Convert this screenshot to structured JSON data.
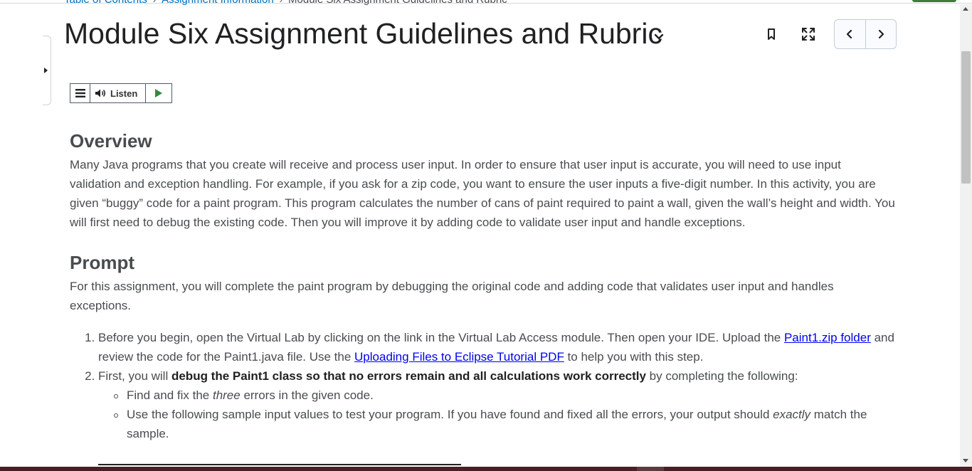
{
  "breadcrumb": {
    "items": [
      "Table of Contents",
      "Assignment Information",
      "Module Six Assignment Guidelines and Rubric"
    ]
  },
  "page": {
    "title": "Module Six Assignment Guidelines and Rubric"
  },
  "icons": {
    "side_toggle": "caret-right-icon",
    "title_menu": "chevron-down-icon",
    "bookmark": "bookmark-icon",
    "fullscreen": "fullscreen-icon",
    "prev": "chevron-left-icon",
    "next": "chevron-right-icon",
    "listen_menu": "hamburger-icon",
    "speaker": "speaker-icon",
    "play": "play-icon"
  },
  "listen": {
    "label": "Listen"
  },
  "overview": {
    "heading": "Overview",
    "text": "Many Java programs that you create will receive and process user input. In order to ensure that user input is accurate, you will need to use input validation and exception handling. For example, if you ask for a zip code, you want to ensure the user inputs a five-digit number. In this activity, you are given “buggy” code for a paint program. This program calculates the number of cans of paint required to paint a wall, given the wall’s height and width. You will first need to debug the existing code. Then you will improve it by adding code to validate user input and handle exceptions."
  },
  "prompt": {
    "heading": "Prompt",
    "text": "For this assignment, you will complete the paint program by debugging the original code and adding code that validates user input and handles exceptions.",
    "step1": {
      "before": "Before you begin, open the Virtual Lab by clicking on the link in the Virtual Lab Access module. Then open your IDE. Upload the ",
      "link1": "Paint1.zip folder",
      "middle": " and review the code for the Paint1.java file. Use the ",
      "link2": "Uploading Files to Eclipse Tutorial PDF",
      "after": " to help you with this step."
    },
    "step2": {
      "before": "First, you will ",
      "bold": "debug the Paint1 class so that no errors remain and all calculations work correctly",
      "after": " by completing the following:",
      "sub1_before": "Find and fix the ",
      "sub1_italic": "three",
      "sub1_after": " errors in the given code.",
      "sub2_before": "Use the following sample input values to test your program. If you have found and fixed all the errors, your output should ",
      "sub2_italic": "exactly",
      "sub2_after": " match the sample."
    }
  },
  "colors": {
    "link": "#006fbf",
    "text": "#494c4e",
    "accent": "#3e7d3a"
  }
}
